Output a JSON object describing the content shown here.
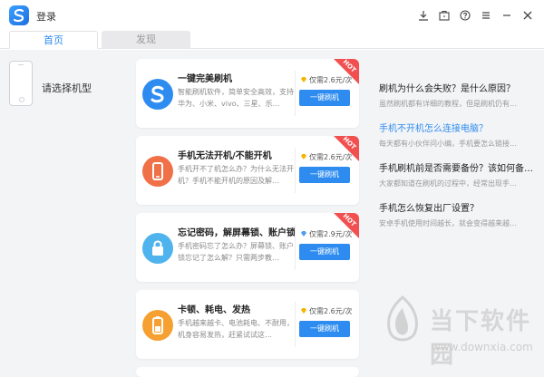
{
  "window": {
    "title": "登录",
    "icons": [
      "download-icon",
      "toolbox-icon",
      "help-icon",
      "menu-icon",
      "minimize-icon",
      "close-icon"
    ]
  },
  "tabs": [
    {
      "label": "首页",
      "active": true
    },
    {
      "label": "发现",
      "active": false
    }
  ],
  "device": {
    "label": "请选择机型"
  },
  "cards": [
    {
      "title": "一键完美刷机",
      "desc": "智能刷机软件，简单安全高效，支持华为、小米、vivo、三星、乐…",
      "price": "仅需2.6元/次",
      "button": "一键刷机",
      "hot": "HOT",
      "icon": "flash-s-icon",
      "color": "#2e8cf0"
    },
    {
      "title": "手机无法开机/不能开机",
      "desc": "手机开不了机怎么办？为什么无法开机？手机不能开机的原因及解…",
      "price": "仅需2.6元/次",
      "button": "一键刷机",
      "hot": "HOT",
      "icon": "phone-icon",
      "color": "#f07048"
    },
    {
      "title": "忘记密码，解屏幕锁、账户锁",
      "desc": "手机密码忘了怎么办？屏幕锁、账户锁忘记了怎么解？只需两步教…",
      "price": "仅需2.9元/次",
      "button": "一键刷机",
      "hot": "HOT",
      "icon": "lock-icon",
      "color": "#4fb3ee"
    },
    {
      "title": "卡顿、耗电、发热",
      "desc": "手机越来越卡、电池耗电、不耐用，机身容易发热，赶紧试试这…",
      "price": "仅需2.6元/次",
      "button": "一键刷机",
      "hot": "",
      "icon": "battery-icon",
      "color": "#f5a030"
    }
  ],
  "faq": [
    {
      "q": "刷机为什么会失败？是什么原因？",
      "a": "虽然刷机都有详细的教程，但是刷机仍有…",
      "link": false
    },
    {
      "q": "手机不开机怎么连接电脑？",
      "a": "每天都有小伙伴问小编，手机要怎么链接…",
      "link": true
    },
    {
      "q": "手机刷机前是否需要备份？该如何备…",
      "a": "大家都知道在刷机的过程中，经常出现手…",
      "link": false
    },
    {
      "q": "手机怎么恢复出厂设置？",
      "a": "安卓手机使用时间越长，就会变得越来越…",
      "link": false
    }
  ],
  "watermark": {
    "title": "当下软件园",
    "url": "www.downxia.com"
  },
  "colors": {
    "accent": "#2e8cf0",
    "hot": "#f25050"
  }
}
